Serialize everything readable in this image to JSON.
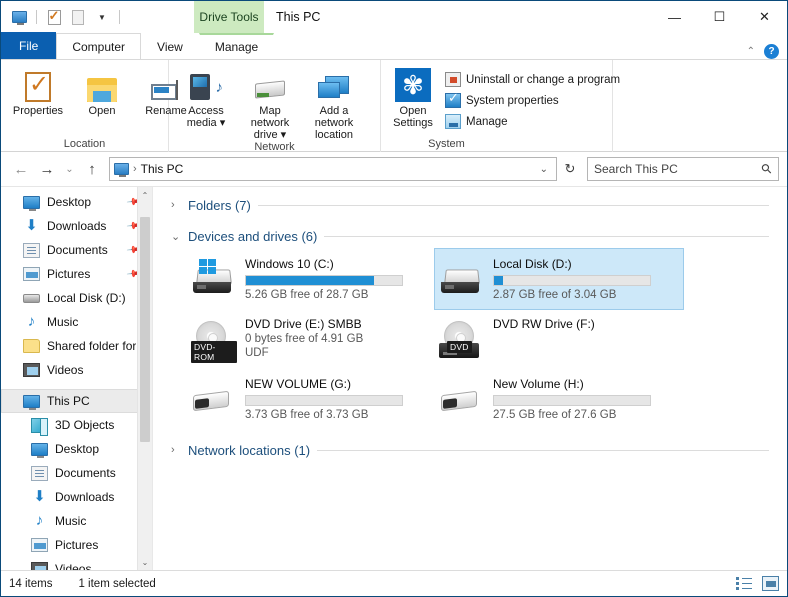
{
  "window": {
    "title": "This PC",
    "context_tab_group": "Drive Tools",
    "controls": {
      "minimize": "—",
      "maximize": "☐",
      "close": "✕"
    },
    "quick_access": [
      "this-pc-icon",
      "properties-icon",
      "new-folder-icon",
      "customize-chevron"
    ]
  },
  "tabs": [
    {
      "label": "File",
      "type": "file"
    },
    {
      "label": "Computer",
      "type": "active"
    },
    {
      "label": "View",
      "type": "normal"
    },
    {
      "label": "Manage",
      "type": "contextual"
    }
  ],
  "ribbon": {
    "collapse_chevron": "⌃",
    "help_label": "?",
    "groups": [
      {
        "name": "Location",
        "buttons": [
          {
            "label": "Properties",
            "icon": "properties-icon"
          },
          {
            "label": "Open",
            "icon": "open-folder-icon"
          },
          {
            "label": "Rename",
            "icon": "rename-icon"
          }
        ]
      },
      {
        "name": "Network",
        "buttons": [
          {
            "label": "Access media ▾",
            "icon": "access-media-icon"
          },
          {
            "label": "Map network drive ▾",
            "icon": "map-network-drive-icon"
          },
          {
            "label": "Add a network location",
            "icon": "add-network-location-icon"
          }
        ]
      },
      {
        "name": "System",
        "big_button": {
          "label": "Open Settings",
          "icon": "settings-gear-icon"
        },
        "items": [
          {
            "label": "Uninstall or change a program",
            "icon": "uninstall-icon"
          },
          {
            "label": "System properties",
            "icon": "system-properties-icon"
          },
          {
            "label": "Manage",
            "icon": "manage-icon"
          }
        ]
      }
    ]
  },
  "addressbar": {
    "back": "←",
    "forward": "→",
    "recent": "⌄",
    "up": "↑",
    "crumb_icon": "this-pc-icon",
    "separator": "›",
    "path": "This PC",
    "dropdown": "⌄",
    "refresh": "↻"
  },
  "search": {
    "placeholder": "Search This PC",
    "icon": "search-icon"
  },
  "sidebar": {
    "quick_access": [
      {
        "label": "Desktop",
        "icon": "desktop-icon",
        "pinned": true
      },
      {
        "label": "Downloads",
        "icon": "downloads-icon",
        "pinned": true
      },
      {
        "label": "Documents",
        "icon": "documents-icon",
        "pinned": true
      },
      {
        "label": "Pictures",
        "icon": "pictures-icon",
        "pinned": true
      },
      {
        "label": "Local Disk (D:)",
        "icon": "disk-icon",
        "pinned": false
      },
      {
        "label": "Music",
        "icon": "music-icon",
        "pinned": false
      },
      {
        "label": "Shared folder for",
        "icon": "folder-icon",
        "pinned": false
      },
      {
        "label": "Videos",
        "icon": "videos-icon",
        "pinned": false
      }
    ],
    "this_pc": [
      {
        "label": "This PC",
        "icon": "this-pc-icon",
        "selected": true
      },
      {
        "label": "3D Objects",
        "icon": "3d-objects-icon",
        "selected": false
      },
      {
        "label": "Desktop",
        "icon": "desktop-icon",
        "selected": false
      },
      {
        "label": "Documents",
        "icon": "documents-icon",
        "selected": false
      },
      {
        "label": "Downloads",
        "icon": "downloads-icon",
        "selected": false
      },
      {
        "label": "Music",
        "icon": "music-icon",
        "selected": false
      },
      {
        "label": "Pictures",
        "icon": "pictures-icon",
        "selected": false
      },
      {
        "label": "Videos",
        "icon": "videos-icon",
        "selected": false
      }
    ],
    "scroll_up": "⌃",
    "scroll_down": "⌄"
  },
  "content": {
    "groups": [
      {
        "title": "Folders (7)",
        "expanded": false,
        "chevron": "›"
      },
      {
        "title": "Devices and drives (6)",
        "expanded": true,
        "chevron": "⌄"
      },
      {
        "title": "Network locations (1)",
        "expanded": false,
        "chevron": "›"
      }
    ],
    "drives": [
      {
        "name": "Windows 10 (C:)",
        "capacity_text": "5.26 GB free of 28.7 GB",
        "extra": "",
        "icon": "windows-drive-icon",
        "has_bar": true,
        "used_percent": 82,
        "bar_color": "#1f8fd4",
        "selected": false
      },
      {
        "name": "Local Disk (D:)",
        "capacity_text": "2.87 GB free of 3.04 GB",
        "extra": "",
        "icon": "hard-drive-icon",
        "has_bar": true,
        "used_percent": 6,
        "bar_color": "#1f8fd4",
        "selected": true
      },
      {
        "name": "DVD Drive (E:) SMBB",
        "capacity_text": "0 bytes free of 4.91 GB",
        "extra": "UDF",
        "icon": "dvd-rom-icon",
        "badge": "DVD-ROM",
        "has_bar": false,
        "selected": false
      },
      {
        "name": "DVD RW Drive (F:)",
        "capacity_text": "",
        "extra": "",
        "icon": "dvd-rw-icon",
        "badge": "DVD",
        "has_bar": false,
        "selected": false
      },
      {
        "name": "NEW VOLUME (G:)",
        "capacity_text": "3.73 GB free of 3.73 GB",
        "extra": "",
        "icon": "usb-drive-icon",
        "has_bar": true,
        "used_percent": 0,
        "bar_color": "#1f8fd4",
        "selected": false
      },
      {
        "name": "New Volume (H:)",
        "capacity_text": "27.5 GB free of 27.6 GB",
        "extra": "",
        "icon": "usb-drive-icon",
        "has_bar": true,
        "used_percent": 0,
        "bar_color": "#1f8fd4",
        "selected": false
      }
    ]
  },
  "statusbar": {
    "item_count": "14 items",
    "selection": "1 item selected",
    "view_details": "details-view-icon",
    "view_tiles": "large-icons-view-icon"
  }
}
